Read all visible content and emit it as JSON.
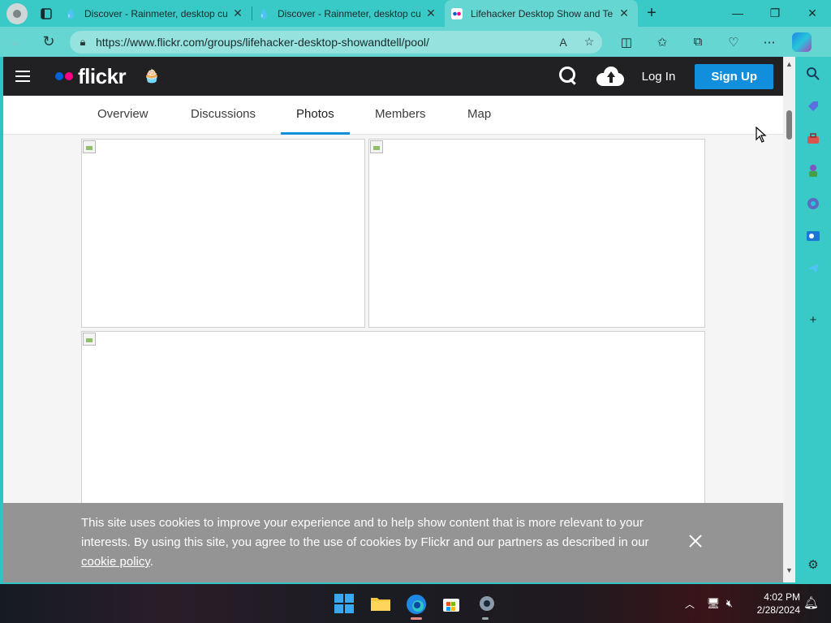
{
  "browser": {
    "tabs": [
      {
        "title": "Discover - Rainmeter, desktop cu",
        "active": false
      },
      {
        "title": "Discover - Rainmeter, desktop cu",
        "active": false
      },
      {
        "title": "Lifehacker Desktop Show and Te",
        "active": true
      }
    ],
    "address": "https://www.flickr.com/groups/lifehacker-desktop-showandtell/pool/"
  },
  "flickr": {
    "logo_text": "flickr",
    "login_label": "Log In",
    "signup_label": "Sign Up",
    "tabs": [
      "Overview",
      "Discussions",
      "Photos",
      "Members",
      "Map"
    ],
    "active_tab": "Photos"
  },
  "cookie_banner": {
    "text": "This site uses cookies to improve your experience and to help show content that is more relevant to your interests. By using this site, you agree to the use of cookies by Flickr and our partners as described in our",
    "link_text": "cookie policy",
    "tail": "."
  },
  "taskbar": {
    "time": "4:02 PM",
    "date": "2/28/2024"
  },
  "colors": {
    "accent": "#128fdc",
    "flickr_blue": "#0063dc",
    "flickr_pink": "#ff0084",
    "header": "#212124",
    "browser": "#39c9c6"
  }
}
